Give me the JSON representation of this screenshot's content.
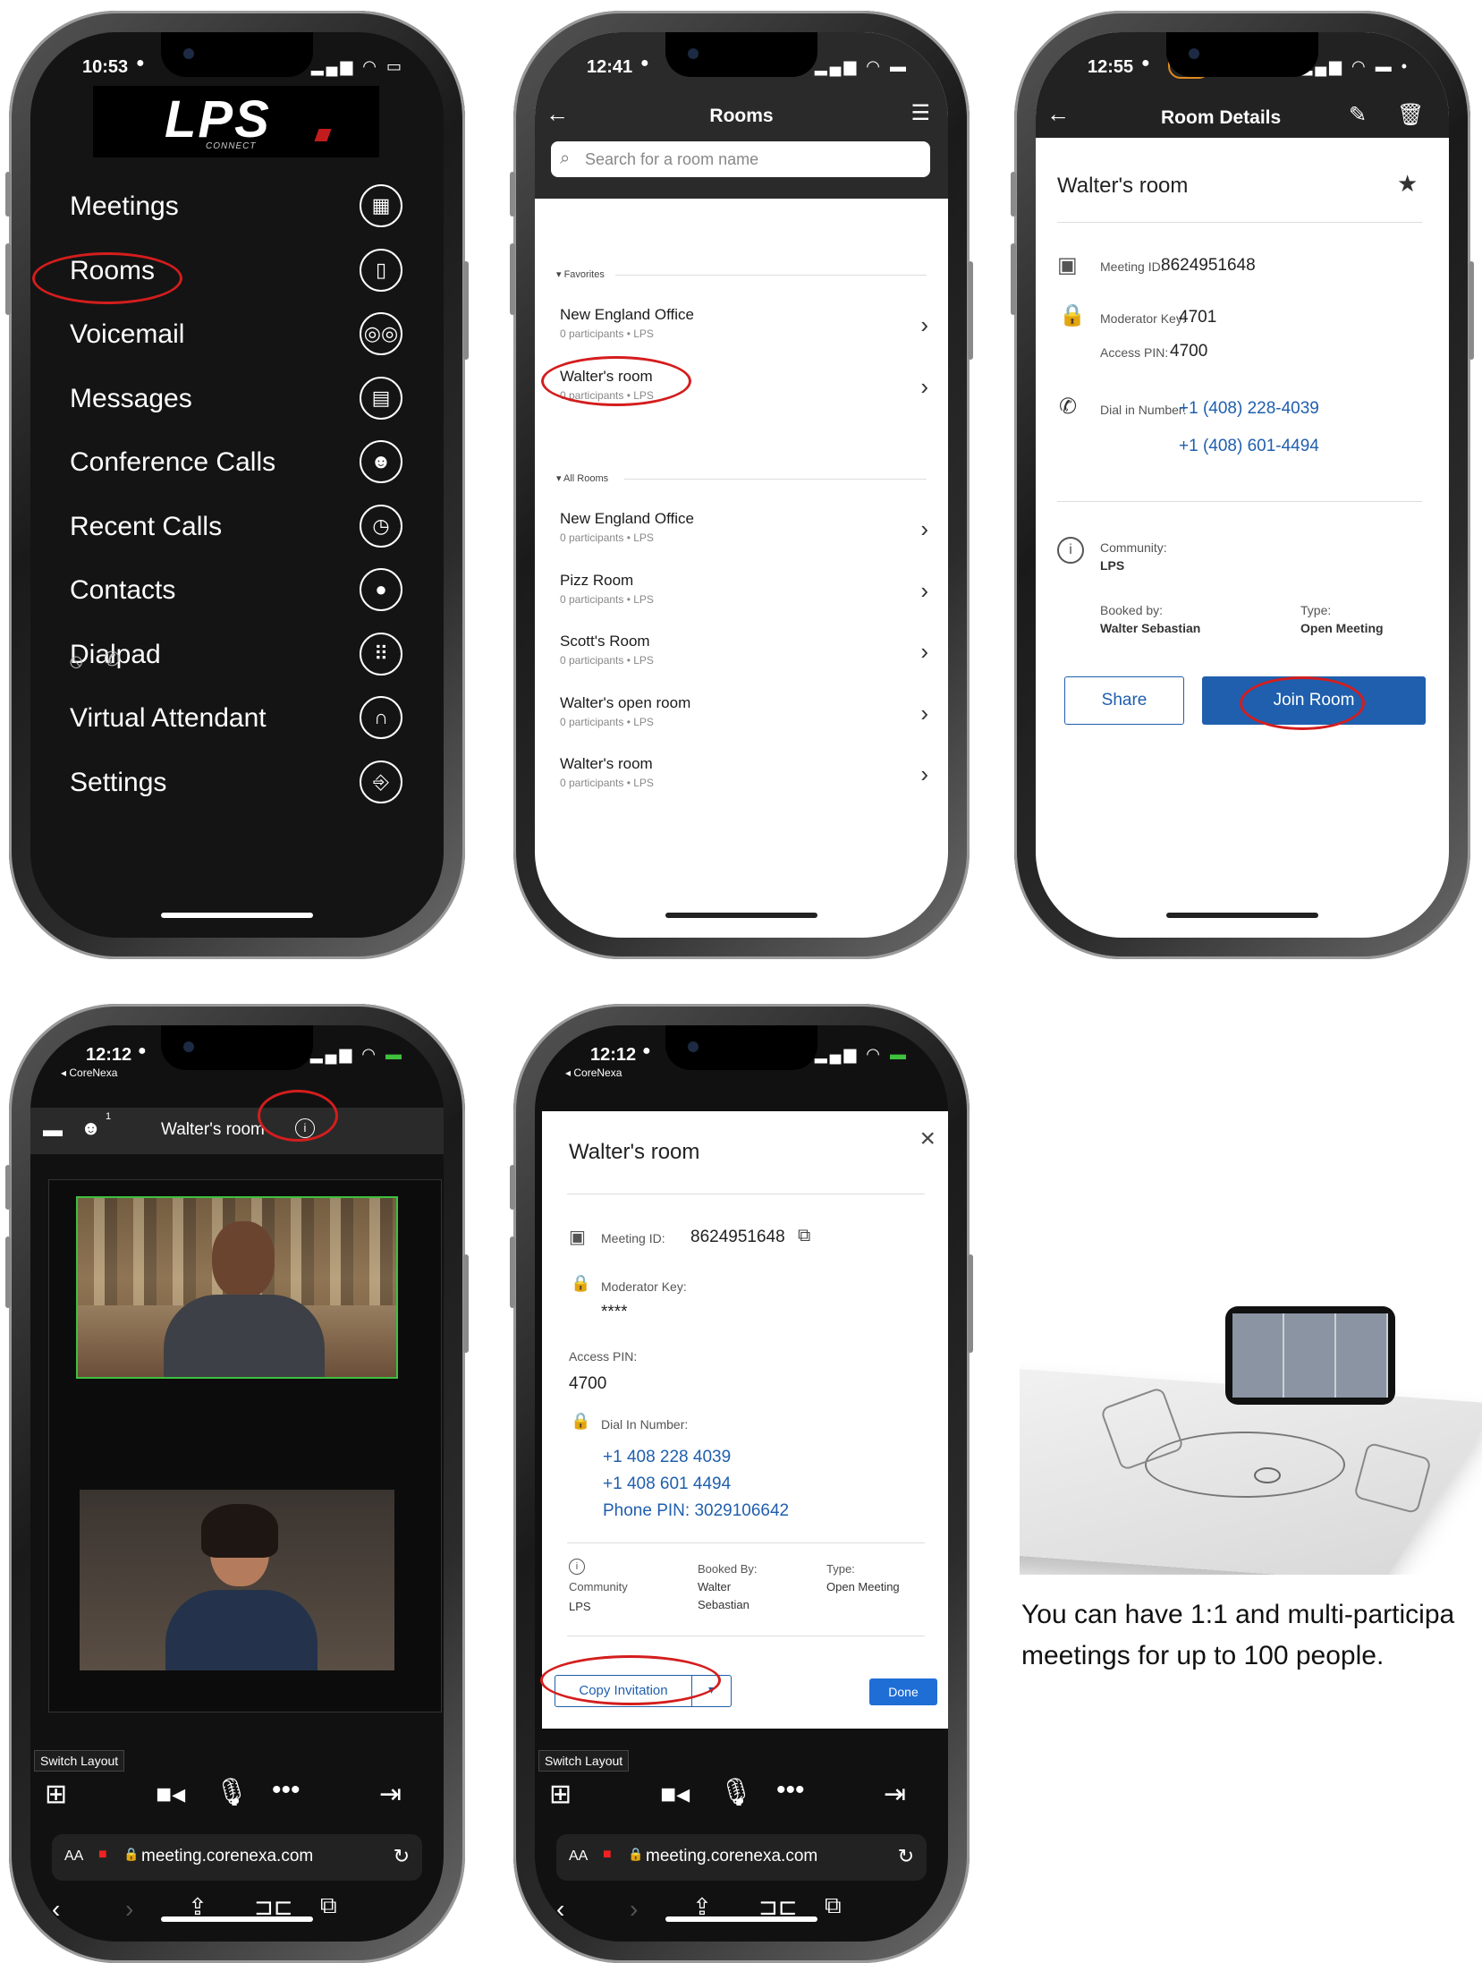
{
  "phone1": {
    "status_time": "10:53",
    "logo": "LPS",
    "logo_sub": "CONNECT",
    "menu": [
      {
        "label": "Meetings",
        "icon": "calendar-icon",
        "glyph": "▦"
      },
      {
        "label": "Rooms",
        "icon": "door-icon",
        "glyph": "▯"
      },
      {
        "label": "Voicemail",
        "icon": "voicemail-icon",
        "glyph": "◎◎"
      },
      {
        "label": "Messages",
        "icon": "chat-icon",
        "glyph": "▤"
      },
      {
        "label": "Conference Calls",
        "icon": "group-icon",
        "glyph": "☻"
      },
      {
        "label": "Recent Calls",
        "icon": "clock-icon",
        "glyph": "◷"
      },
      {
        "label": "Contacts",
        "icon": "person-icon",
        "glyph": "●"
      },
      {
        "label": "Dialpad",
        "icon": "dialpad-icon",
        "glyph": "⠿"
      },
      {
        "label": "Virtual Attendant",
        "icon": "headset-icon",
        "glyph": "∩"
      },
      {
        "label": "Settings",
        "icon": "exit-icon",
        "glyph": "⎆"
      }
    ]
  },
  "phone2": {
    "status_time": "12:41",
    "title": "Rooms",
    "search_placeholder": "Search for a room name",
    "favorites_label": "Favorites",
    "all_rooms_label": "All Rooms",
    "favorites": [
      {
        "name": "New England Office",
        "meta": "0 participants • LPS"
      },
      {
        "name": "Walter's room",
        "meta": "0 participants • LPS"
      }
    ],
    "all_rooms": [
      {
        "name": "New England Office",
        "meta": "0 participants • LPS"
      },
      {
        "name": "Pizz Room",
        "meta": "0 participants • LPS"
      },
      {
        "name": "Scott's Room",
        "meta": "0 participants • LPS"
      },
      {
        "name": "Walter's open room",
        "meta": "0 participants • LPS"
      },
      {
        "name": "Walter's room",
        "meta": "0 participants • LPS"
      }
    ]
  },
  "phone3": {
    "status_time": "12:55",
    "title": "Room Details",
    "room_name": "Walter's room",
    "meeting_id_label": "Meeting ID:",
    "meeting_id": "8624951648",
    "moderator_key_label": "Moderator Key:",
    "moderator_key": "4701",
    "access_pin_label": "Access PIN:",
    "access_pin": "4700",
    "dial_in_label": "Dial in Number:",
    "dial_in_1": "+1 (408) 228-4039",
    "dial_in_2": "+1 (408) 601-4494",
    "community_label": "Community:",
    "community": "LPS",
    "booked_by_label": "Booked by:",
    "booked_by": "Walter Sebastian",
    "type_label": "Type:",
    "type": "Open Meeting",
    "share_label": "Share",
    "join_label": "Join Room"
  },
  "phone4": {
    "status_time": "12:12",
    "back_app": "◂ CoreNexa",
    "participants_count": "1",
    "room_title": "Walter's room",
    "switch_layout": "Switch Layout",
    "url": "meeting.corenexa.com",
    "aa": "AA"
  },
  "phone5": {
    "status_time": "12:12",
    "back_app": "◂ CoreNexa",
    "dialog_title": "Walter's room",
    "meeting_id_label": "Meeting ID:",
    "meeting_id": "8624951648",
    "moderator_key_label": "Moderator Key:",
    "moderator_key": "****",
    "access_pin_label": "Access PIN:",
    "access_pin": "4700",
    "dial_in_label": "Dial In Number:",
    "dial_1": "+1 408 228 4039",
    "dial_2": "+1 408 601 4494",
    "phone_pin": "Phone PIN: 3029106642",
    "community_label": "Community",
    "community": "LPS",
    "booked_by_label": "Booked By:",
    "booked_by_1": "Walter",
    "booked_by_2": "Sebastian",
    "type_label": "Type:",
    "type": "Open Meeting",
    "copy_label": "Copy Invitation",
    "done_label": "Done",
    "switch_layout": "Switch Layout",
    "url": "meeting.corenexa.com",
    "aa": "AA"
  },
  "caption": {
    "line1": "You can have 1:1 and multi-participa",
    "line2": "meetings for up to 100 people."
  }
}
